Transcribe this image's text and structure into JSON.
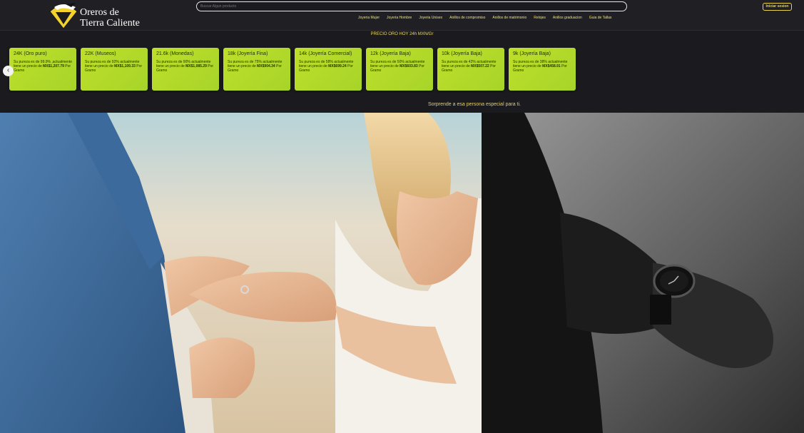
{
  "brand": {
    "line1": "Oreros de",
    "line2": "Tierra Caliente"
  },
  "search": {
    "placeholder": "Buscar Algun producto"
  },
  "nav": [
    "Joyeria Mujer",
    "Joyeria Hombre",
    "Joyeria Unisex",
    "Anillos de compromiso",
    "Anillos de matrimonio",
    "Relojes",
    "Anillos graduacion",
    "Guia de Tallas"
  ],
  "login_label": "Iniciar sesion",
  "price_title": "PRECIO ORO HOY 24h MXN/Gr",
  "prev_icon": "‹",
  "cards": [
    {
      "title": "24K (Oro puro)",
      "desc_pre": "Su pureza es de 99.9% ,actualmente tiene un precio de ",
      "price": "MX$1,207.79",
      "desc_post": " Por Gramo"
    },
    {
      "title": "22K (Museos)",
      "desc_pre": "Su pureza es de 92% actualmente tiene un precio de ",
      "price": "MX$1,109.33",
      "desc_post": " Por Gramo"
    },
    {
      "title": "21.6k (Monedas)",
      "desc_pre": "Su pureza es de 90% actualmente tiene un precio de ",
      "price": "MX$1,085.29",
      "desc_post": " Por Gramo"
    },
    {
      "title": "18k (Joyería Fina)",
      "desc_pre": "Su pureza es de 75% actualmente tiene un precio de ",
      "price": "MX$904.34",
      "desc_post": " Por Gramo"
    },
    {
      "title": "14k (Joyería Comercial)",
      "desc_pre": "Su pureza es de 58% actualmente tiene un precio de ",
      "price": "MX$699.24",
      "desc_post": " Por Gramo"
    },
    {
      "title": "12k (Joyería Baja)",
      "desc_pre": "Su pureza es de 50% actualmente tiene un precio de ",
      "price": "MX$603.83",
      "desc_post": " Por Gramo"
    },
    {
      "title": "10k (Joyería Baja)",
      "desc_pre": "Su pureza es de 42% actualmente tiene un precio de ",
      "price": "MX$507.22",
      "desc_post": " Por Gramo"
    },
    {
      "title": "9k (Joyería Baja)",
      "desc_pre": "Su pureza es de 38% actualmente tiene un precio de ",
      "price": "MX$458.91",
      "desc_post": " Por Gramo"
    }
  ],
  "tagline": "Sorprende a esa persona especial para ti.",
  "colors": {
    "accent": "#e8d34a",
    "card": "#b5da2a",
    "background": "#1b1b1f"
  }
}
